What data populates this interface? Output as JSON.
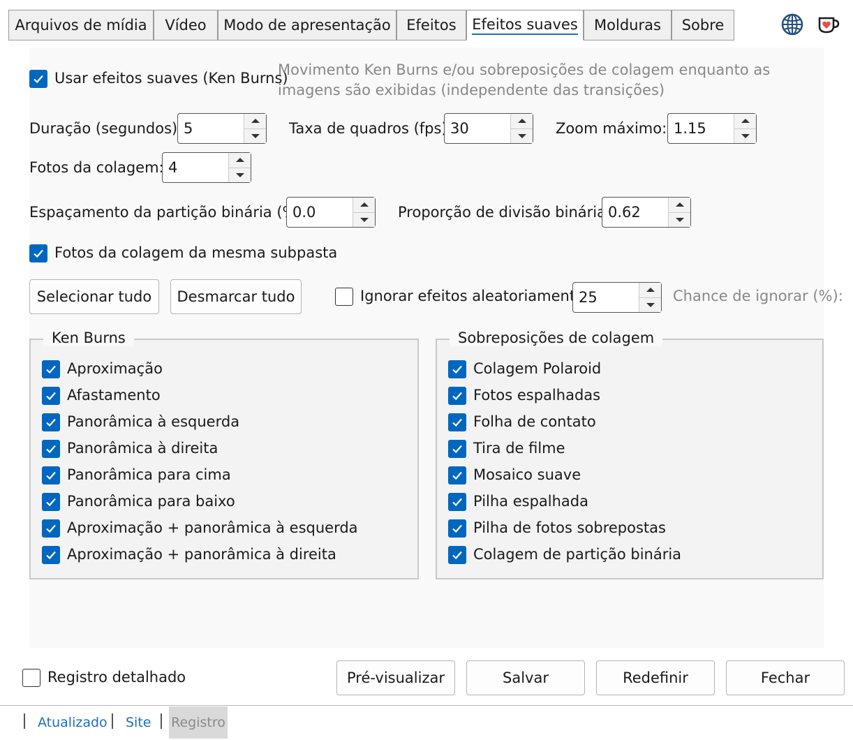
{
  "tabs": [
    {
      "label": "Arquivos de mídia"
    },
    {
      "label": "Vídeo"
    },
    {
      "label": "Modo de apresentação"
    },
    {
      "label": "Efeitos"
    },
    {
      "label": "Efeitos suaves",
      "active": true
    },
    {
      "label": "Molduras"
    },
    {
      "label": "Sobre"
    }
  ],
  "top_icons": [
    "globe-icon",
    "coffee-heart-icon"
  ],
  "settings": {
    "use_soft_effects_label": "Usar efeitos suaves (Ken Burns)",
    "use_soft_effects_checked": true,
    "use_soft_effects_hint": "Movimento Ken Burns e/ou sobreposições de colagem enquanto as imagens são exibidas (independente das transições)",
    "duration_label": "Duração (segundos):",
    "duration_value": "5",
    "fps_label": "Taxa de quadros (fps):",
    "fps_value": "30",
    "max_zoom_label": "Zoom máximo:",
    "max_zoom_value": "1.15",
    "collage_photos_label": "Fotos da colagem:",
    "collage_photos_value": "4",
    "bsp_spacing_label": "Espaçamento da partição binária (%):",
    "bsp_spacing_value": "0.0",
    "bsp_ratio_label": "Proporção de divisão binária:",
    "bsp_ratio_value": "0.62",
    "same_subfolder_label": "Fotos da colagem da mesma subpasta",
    "same_subfolder_checked": true,
    "select_all_label": "Selecionar tudo",
    "deselect_all_label": "Desmarcar tudo",
    "random_skip_label": "Ignorar efeitos aleatoriamente",
    "random_skip_checked": false,
    "skip_chance_value": "25",
    "skip_chance_label": "Chance de ignorar (%):"
  },
  "ken_burns": {
    "title": "Ken Burns",
    "items": [
      {
        "label": "Aproximação",
        "checked": true
      },
      {
        "label": "Afastamento",
        "checked": true
      },
      {
        "label": "Panorâmica à esquerda",
        "checked": true
      },
      {
        "label": "Panorâmica à direita",
        "checked": true
      },
      {
        "label": "Panorâmica para cima",
        "checked": true
      },
      {
        "label": "Panorâmica para baixo",
        "checked": true
      },
      {
        "label": "Aproximação + panorâmica à esquerda",
        "checked": true
      },
      {
        "label": "Aproximação + panorâmica à direita",
        "checked": true
      }
    ]
  },
  "collage": {
    "title": "Sobreposições de colagem",
    "items": [
      {
        "label": "Colagem Polaroid",
        "checked": true
      },
      {
        "label": "Fotos espalhadas",
        "checked": true
      },
      {
        "label": "Folha de contato",
        "checked": true
      },
      {
        "label": "Tira de filme",
        "checked": true
      },
      {
        "label": "Mosaico suave",
        "checked": true
      },
      {
        "label": "Pilha espalhada",
        "checked": true
      },
      {
        "label": "Pilha de fotos sobrepostas",
        "checked": true
      },
      {
        "label": "Colagem de partição binária",
        "checked": true
      }
    ]
  },
  "footer": {
    "verbose_log_label": "Registro detalhado",
    "verbose_log_checked": false,
    "preview_label": "Pré-visualizar",
    "save_label": "Salvar",
    "reset_label": "Redefinir",
    "close_label": "Fechar"
  },
  "statusbar": {
    "updated_label": "Atualizado",
    "site_label": "Site",
    "log_label": "Registro"
  },
  "colors": {
    "accent": "#0067c0",
    "link": "#1a6ec0",
    "hint": "#888888"
  }
}
